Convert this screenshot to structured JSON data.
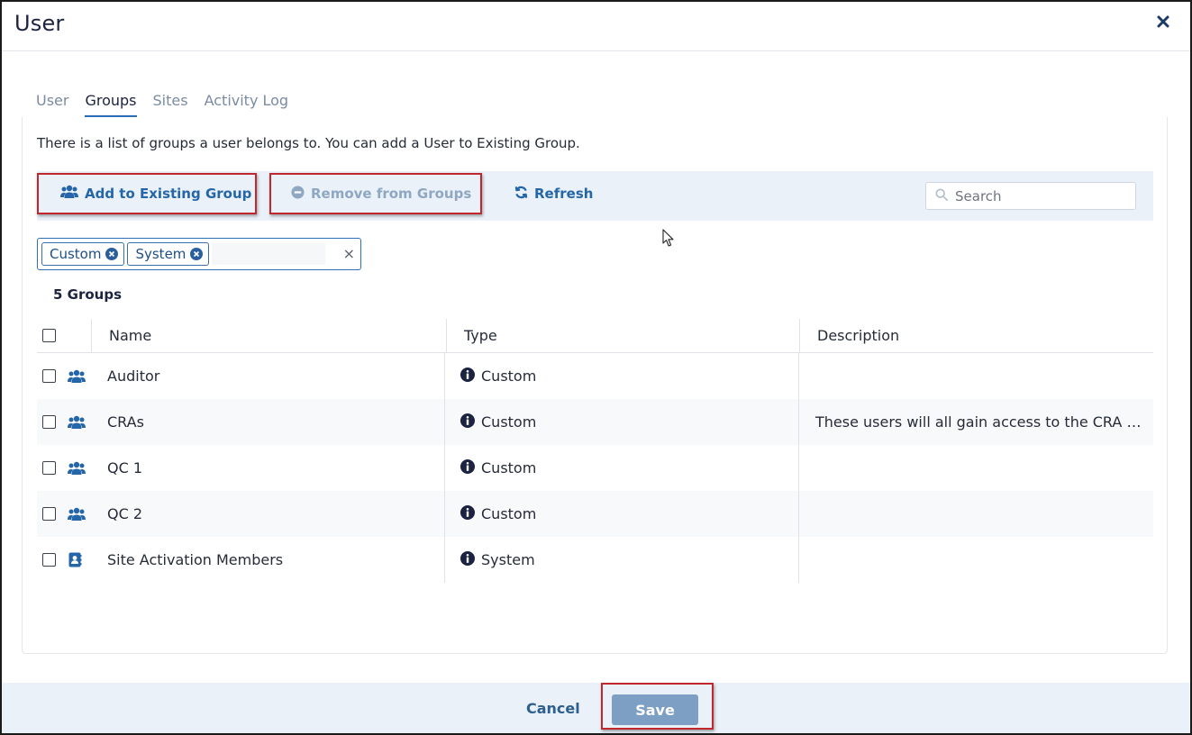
{
  "dialog": {
    "title": "User"
  },
  "tabs": [
    {
      "label": "User",
      "active": false
    },
    {
      "label": "Groups",
      "active": true
    },
    {
      "label": "Sites",
      "active": false
    },
    {
      "label": "Activity Log",
      "active": false
    }
  ],
  "description": "There is a list of groups a user belongs to. You can add a User to Existing Group.",
  "toolbar": {
    "add_label": "Add to Existing Group",
    "remove_label": "Remove from Groups",
    "refresh_label": "Refresh",
    "search_placeholder": "Search"
  },
  "filters": {
    "chips": [
      "Custom",
      "System"
    ],
    "clear_symbol": "×"
  },
  "groups_count": "5 Groups",
  "table": {
    "columns": [
      "Name",
      "Type",
      "Description"
    ],
    "rows": [
      {
        "icon": "users-icon",
        "name": "Auditor",
        "type": "Custom",
        "description": ""
      },
      {
        "icon": "users-icon",
        "name": "CRAs",
        "type": "Custom",
        "description": "These users will all gain access to the CRA Re..."
      },
      {
        "icon": "users-icon",
        "name": "QC 1",
        "type": "Custom",
        "description": ""
      },
      {
        "icon": "users-icon",
        "name": "QC 2",
        "type": "Custom",
        "description": ""
      },
      {
        "icon": "address-book-icon",
        "name": "Site Activation Members",
        "type": "System",
        "description": ""
      }
    ]
  },
  "footer": {
    "cancel_label": "Cancel",
    "save_label": "Save"
  },
  "colors": {
    "accent": "#2466a8",
    "highlight": "#c0282d",
    "toolbar_bg": "#eaf1f9",
    "save_bg": "#7d9fc4"
  }
}
